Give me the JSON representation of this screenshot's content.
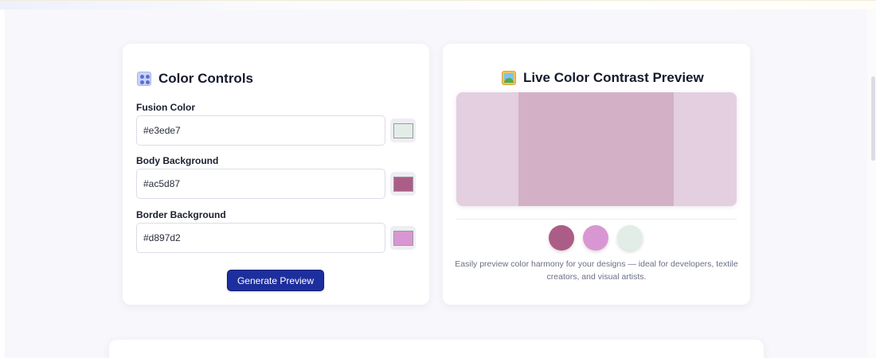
{
  "controls": {
    "title": "Color Controls",
    "icon": "palette-icon",
    "fields": [
      {
        "label": "Fusion Color",
        "value": "#e3ede7",
        "swatch": "#e3ede7"
      },
      {
        "label": "Body Background",
        "value": "#ac5d87",
        "swatch": "#ac5d87"
      },
      {
        "label": "Border Background",
        "value": "#d897d2",
        "swatch": "#d897d2"
      }
    ],
    "generate_label": "Generate Preview",
    "button_color": "#1d2e9e"
  },
  "preview": {
    "title": "Live Color Contrast Preview",
    "icon": "picture-icon",
    "outer_color": "#e3cfe0",
    "inner_color": "#d3b0c6",
    "dots": [
      "#ac5d87",
      "#d897d2",
      "#e3ede7"
    ],
    "description": "Easily preview color harmony for your designs — ideal for developers, textile creators, and visual artists."
  }
}
